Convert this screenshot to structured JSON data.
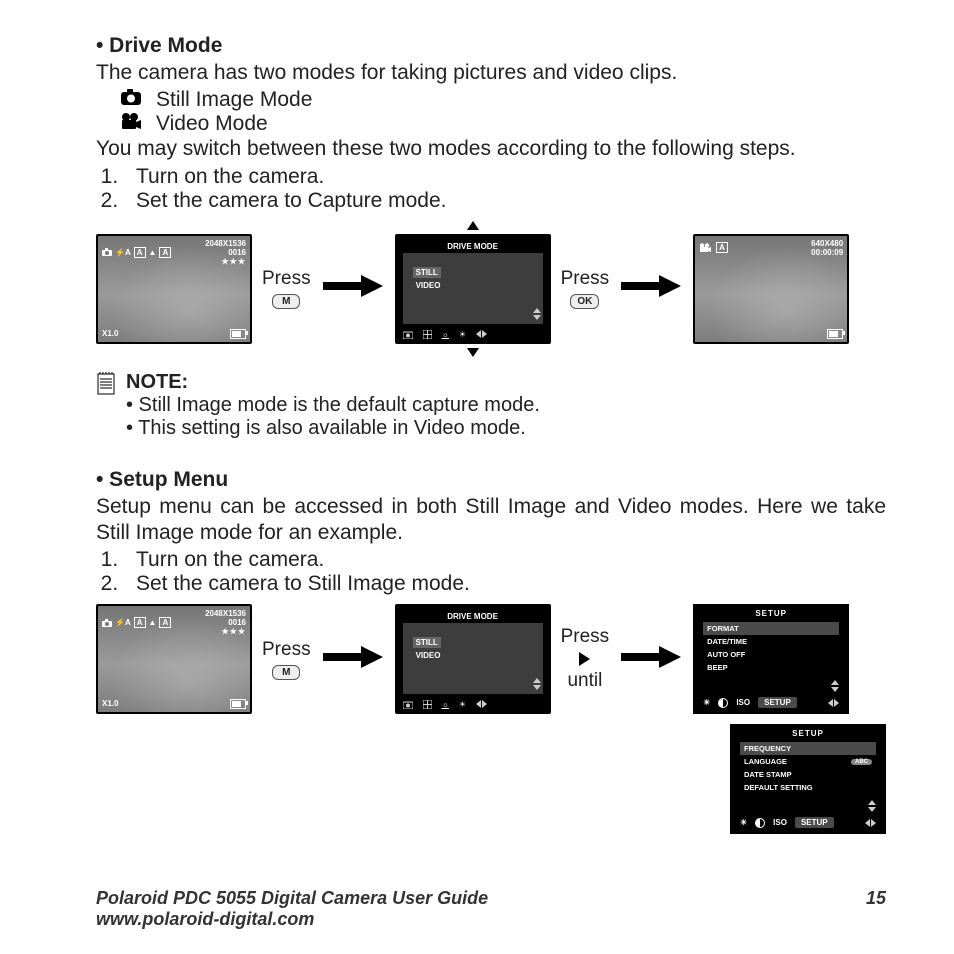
{
  "sections": {
    "drive": {
      "heading": "• Drive Mode",
      "intro": "The camera has two modes for taking pictures and video clips.",
      "mode_still": "Still Image Mode",
      "mode_video": "Video Mode",
      "switch_text": "You may switch between these two modes according to the following steps.",
      "step1": "Turn on the camera.",
      "step2": "Set the camera to Capture mode."
    },
    "note": {
      "label": "NOTE:",
      "b1": "• Still Image mode is the default capture mode.",
      "b2": "• This setting is also available in Video mode."
    },
    "setup": {
      "heading": "• Setup Menu",
      "intro": "Setup menu can be accessed in both Still Image and Video modes. Here we take Still Image mode for an example.",
      "step1": "Turn on the camera.",
      "step2": "Set the camera to Still Image mode."
    }
  },
  "labels": {
    "press": "Press",
    "until": "until",
    "m": "M",
    "ok": "OK"
  },
  "lcd_still": {
    "flash": "⚡A",
    "a1": "A",
    "a2": "A",
    "res": "2048X1536",
    "count": "0016",
    "stars": "★★★",
    "zoom": "X1.0"
  },
  "lcd_video": {
    "a": "A",
    "res": "640X480",
    "time": "00:00:09"
  },
  "drive_menu": {
    "title": "DRIVE MODE",
    "still": "STILL",
    "video": "VIDEO"
  },
  "setup_menu": {
    "title": "SETUP",
    "items1": [
      "FORMAT",
      "DATE/TIME",
      "AUTO OFF",
      "BEEP"
    ],
    "items2": [
      "FREQUENCY",
      "LANGUAGE",
      "DATE STAMP",
      "DEFAULT SETTING"
    ],
    "iso": "ISO",
    "setup_tab": "SETUP",
    "abc": "ABC"
  },
  "footer": {
    "title": "Polaroid PDC 5055 Digital Camera User Guide",
    "url": "www.polaroid-digital.com",
    "page": "15"
  }
}
